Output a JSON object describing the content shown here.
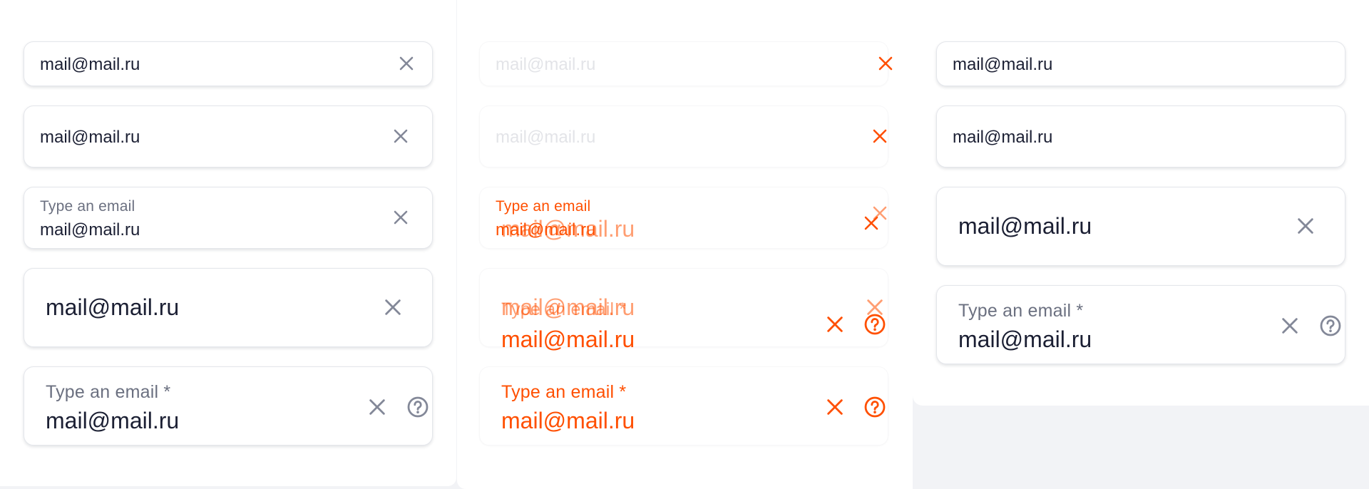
{
  "email_value": "mail@mail.ru",
  "label": "Type an email",
  "label_required": "Type an email *",
  "colors": {
    "text": "#1b1f33",
    "icon": "#838898",
    "label": "#6b7080",
    "error": "#ff4f00",
    "border": "#e4e6eb"
  },
  "icons": {
    "clear": "close-icon",
    "help": "help-icon"
  }
}
